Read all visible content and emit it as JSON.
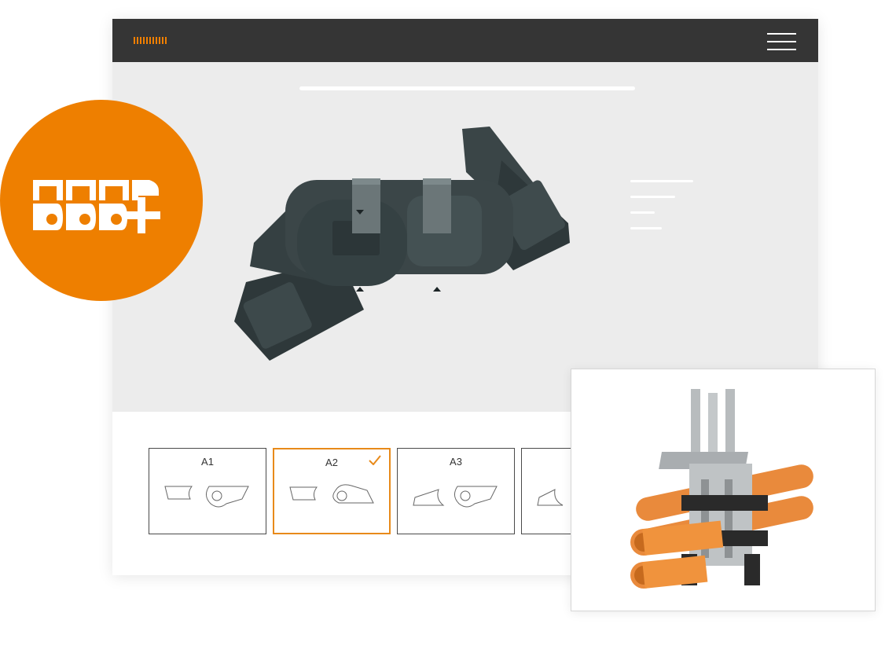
{
  "colors": {
    "brand_orange": "#ee7f00",
    "topbar": "#353535",
    "hero_bg": "#ececec",
    "selected_border": "#e88a1a"
  },
  "topbar": {
    "logo_icon": "brand-stripes-icon",
    "menu_icon": "hamburger-menu-icon"
  },
  "badge": {
    "icon": "chain-plus-logo-icon"
  },
  "hero": {
    "image": "energy-chain-product-image"
  },
  "variants": [
    {
      "label": "A1",
      "selected": false
    },
    {
      "label": "A2",
      "selected": true
    },
    {
      "label": "A3",
      "selected": false
    },
    {
      "label": "",
      "selected": false
    }
  ],
  "photo": {
    "image": "cable-separator-with-orange-cables-image"
  }
}
